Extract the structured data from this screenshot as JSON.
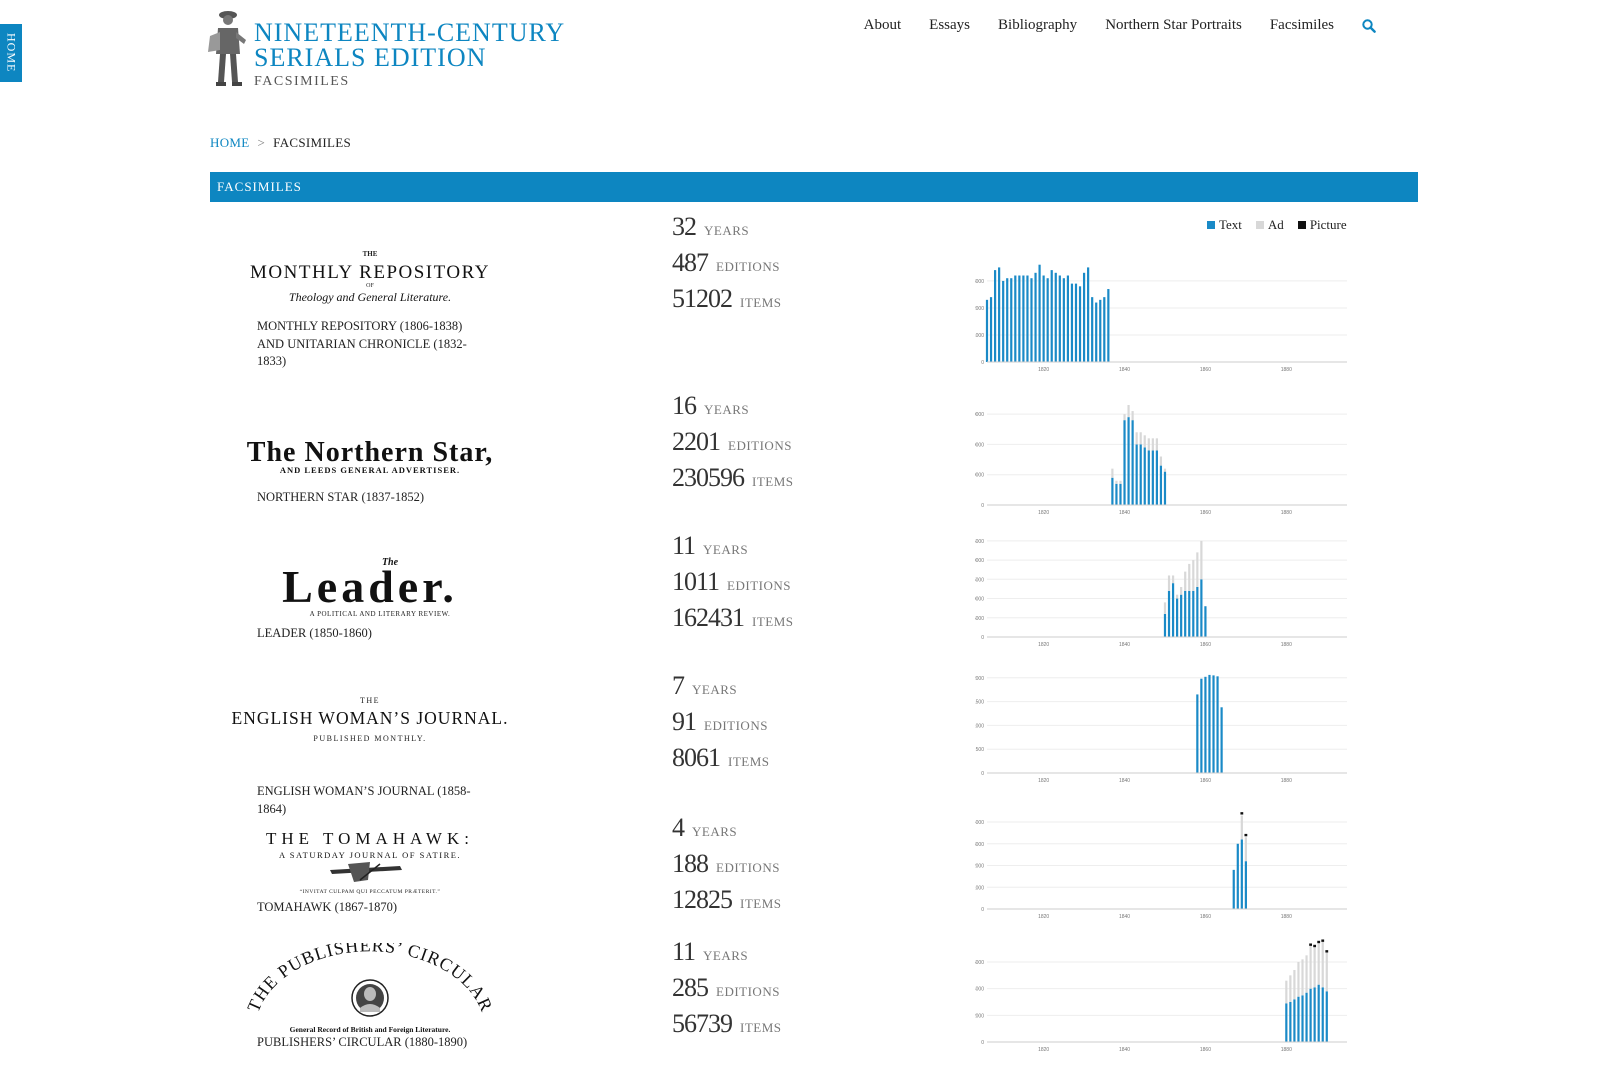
{
  "home_tab": "HOME",
  "logo": {
    "line1": "NINETEENTH-CENTURY",
    "line2": "SERIALS EDITION",
    "sub": "FACSIMILES"
  },
  "nav": [
    "About",
    "Essays",
    "Bibliography",
    "Northern Star Portraits",
    "Facsimiles"
  ],
  "breadcrumb": {
    "home": "HOME",
    "separator": ">",
    "current": "FACSIMILES"
  },
  "section_title": "FACSIMILES",
  "legend": [
    {
      "label": "Text",
      "color": "#1a8ac7"
    },
    {
      "label": "Ad",
      "color": "#d8d8d8"
    },
    {
      "label": "Picture",
      "color": "#111111"
    }
  ],
  "stat_labels": {
    "years": "YEARS",
    "editions": "EDITIONS",
    "items": "ITEMS"
  },
  "publications": [
    {
      "title": "MONTHLY REPOSITORY (1806-1838) AND UNITARIAN CHRONICLE (1832-1833)",
      "masthead": {
        "kicker": "THE",
        "main": "MONTHLY REPOSITORY",
        "of": "OF",
        "sub": "Theology and General Literature."
      },
      "years": "32",
      "editions": "487",
      "items": "51202"
    },
    {
      "title": "NORTHERN STAR (1837-1852)",
      "masthead": {
        "main": "The Northern Star,",
        "sub": "AND LEEDS GENERAL ADVERTISER."
      },
      "years": "16",
      "editions": "2201",
      "items": "230596"
    },
    {
      "title": "LEADER (1850-1860)",
      "masthead": {
        "kicker": "The",
        "main": "Leader.",
        "sub": "A POLITICAL AND LITERARY REVIEW."
      },
      "years": "11",
      "editions": "1011",
      "items": "162431"
    },
    {
      "title": "ENGLISH WOMAN’S JOURNAL (1858-1864)",
      "masthead": {
        "kicker": "THE",
        "main": "ENGLISH WOMAN’S JOURNAL.",
        "sub": "PUBLISHED MONTHLY."
      },
      "years": "7",
      "editions": "91",
      "items": "8061"
    },
    {
      "title": "TOMAHAWK (1867-1870)",
      "masthead": {
        "main": "THE TOMAHAWK:",
        "sub": "A SATURDAY JOURNAL OF SATIRE.",
        "motto": "“INVITAT CULPAM QUI PECCATUM PRÆTERIT.”"
      },
      "years": "4",
      "editions": "188",
      "items": "12825"
    },
    {
      "title": "PUBLISHERS’ CIRCULAR (1880-1890)",
      "masthead": {
        "main": "THE PUBLISHERS’ CIRCULAR",
        "sub": "General Record of British and Foreign Literature."
      },
      "years": "11",
      "editions": "285",
      "items": "56739"
    }
  ],
  "chart_data": [
    {
      "type": "bar",
      "stacked": true,
      "x_ticks": [
        "1820",
        "1840",
        "1860",
        "1880"
      ],
      "xlim": [
        1806,
        1895
      ],
      "y_ticks": [
        "0",
        "1000",
        "2000",
        "3000"
      ],
      "ylim": [
        0,
        3700
      ],
      "x": [
        1806,
        1807,
        1808,
        1809,
        1810,
        1811,
        1812,
        1813,
        1814,
        1815,
        1816,
        1817,
        1818,
        1819,
        1820,
        1821,
        1822,
        1823,
        1824,
        1825,
        1826,
        1827,
        1828,
        1829,
        1830,
        1831,
        1832,
        1833,
        1834,
        1835,
        1836,
        1837,
        1838
      ],
      "series": [
        {
          "name": "Text",
          "values": [
            2300,
            2400,
            3400,
            3500,
            3000,
            3100,
            3100,
            3200,
            3200,
            3200,
            3200,
            3100,
            3300,
            3600,
            3200,
            3100,
            3400,
            3300,
            3200,
            3100,
            3200,
            2900,
            2900,
            2800,
            3300,
            3500,
            2400,
            2200,
            2300,
            2400,
            2700,
            0,
            0
          ]
        },
        {
          "name": "Ad",
          "values": [
            0,
            0,
            0,
            0,
            0,
            0,
            0,
            0,
            0,
            0,
            0,
            0,
            0,
            0,
            0,
            0,
            0,
            0,
            0,
            0,
            0,
            0,
            0,
            0,
            0,
            0,
            0,
            0,
            0,
            0,
            0,
            0,
            0
          ]
        },
        {
          "name": "Picture",
          "values": [
            0,
            0,
            0,
            0,
            0,
            0,
            0,
            0,
            0,
            0,
            0,
            0,
            0,
            0,
            0,
            0,
            0,
            0,
            0,
            0,
            0,
            0,
            0,
            0,
            0,
            0,
            0,
            0,
            0,
            0,
            0,
            0,
            0
          ]
        }
      ]
    },
    {
      "type": "bar",
      "stacked": true,
      "x_ticks": [
        "1820",
        "1840",
        "1860",
        "1880"
      ],
      "xlim": [
        1806,
        1895
      ],
      "y_ticks": [
        "0",
        "10000",
        "20000",
        "30000"
      ],
      "ylim": [
        0,
        33000
      ],
      "x": [
        1837,
        1838,
        1839,
        1840,
        1841,
        1842,
        1843,
        1844,
        1845,
        1846,
        1847,
        1848,
        1849,
        1850,
        1851,
        1852
      ],
      "series": [
        {
          "name": "Text",
          "values": [
            9000,
            7000,
            7000,
            28000,
            29000,
            28000,
            20000,
            20000,
            19000,
            18000,
            18000,
            18000,
            13000,
            11000,
            0,
            0
          ]
        },
        {
          "name": "Ad",
          "values": [
            3000,
            1000,
            1000,
            2000,
            4000,
            3000,
            4000,
            4000,
            4000,
            4000,
            4000,
            4000,
            3000,
            1000,
            0,
            0
          ]
        },
        {
          "name": "Picture",
          "values": [
            0,
            0,
            0,
            0,
            0,
            0,
            0,
            0,
            0,
            0,
            0,
            0,
            0,
            0,
            0,
            0
          ]
        }
      ]
    },
    {
      "type": "bar",
      "stacked": true,
      "x_ticks": [
        "1820",
        "1840",
        "1860",
        "1880"
      ],
      "xlim": [
        1806,
        1895
      ],
      "y_ticks": [
        "0",
        "5000",
        "10000",
        "15000",
        "20000",
        "25000"
      ],
      "ylim": [
        0,
        26000
      ],
      "x": [
        1850,
        1851,
        1852,
        1853,
        1854,
        1855,
        1856,
        1857,
        1858,
        1859,
        1860
      ],
      "series": [
        {
          "name": "Text",
          "values": [
            6000,
            12000,
            14000,
            10000,
            11000,
            12000,
            12000,
            12000,
            13000,
            15000,
            8000
          ]
        },
        {
          "name": "Ad",
          "values": [
            3000,
            4000,
            2000,
            1000,
            2000,
            5000,
            7000,
            8000,
            9000,
            10000,
            0
          ]
        },
        {
          "name": "Picture",
          "values": [
            0,
            0,
            0,
            0,
            0,
            0,
            0,
            0,
            0,
            0,
            0
          ]
        }
      ]
    },
    {
      "type": "bar",
      "stacked": true,
      "x_ticks": [
        "1820",
        "1840",
        "1860",
        "1880"
      ],
      "xlim": [
        1806,
        1895
      ],
      "y_ticks": [
        "0",
        "500",
        "1000",
        "1500",
        "2000"
      ],
      "ylim": [
        0,
        2100
      ],
      "x": [
        1858,
        1859,
        1860,
        1861,
        1862,
        1863,
        1864
      ],
      "series": [
        {
          "name": "Text",
          "values": [
            1650,
            1980,
            2020,
            2060,
            2050,
            2030,
            1380
          ]
        },
        {
          "name": "Ad",
          "values": [
            0,
            0,
            0,
            0,
            0,
            0,
            0
          ]
        },
        {
          "name": "Picture",
          "values": [
            0,
            0,
            0,
            0,
            0,
            0,
            0
          ]
        }
      ]
    },
    {
      "type": "bar",
      "stacked": true,
      "x_ticks": [
        "1820",
        "1840",
        "1860",
        "1880"
      ],
      "xlim": [
        1806,
        1895
      ],
      "y_ticks": [
        "0",
        "1000",
        "2000",
        "3000",
        "4000"
      ],
      "ylim": [
        0,
        4600
      ],
      "x": [
        1867,
        1868,
        1869,
        1870
      ],
      "series": [
        {
          "name": "Text",
          "values": [
            1800,
            3000,
            3200,
            2200
          ]
        },
        {
          "name": "Ad",
          "values": [
            0,
            0,
            1100,
            1100
          ]
        },
        {
          "name": "Picture",
          "values": [
            0,
            0,
            100,
            100
          ]
        }
      ]
    },
    {
      "type": "bar",
      "stacked": true,
      "x_ticks": [
        "1820",
        "1840",
        "1860",
        "1880"
      ],
      "xlim": [
        1806,
        1895
      ],
      "y_ticks": [
        "0",
        "2000",
        "4000",
        "6000"
      ],
      "ylim": [
        0,
        7500
      ],
      "x": [
        1880,
        1881,
        1882,
        1883,
        1884,
        1885,
        1886,
        1887,
        1888,
        1889,
        1890
      ],
      "series": [
        {
          "name": "Text",
          "values": [
            2900,
            3000,
            3200,
            3400,
            3500,
            3700,
            4000,
            4100,
            4300,
            4100,
            3800
          ]
        },
        {
          "name": "Ad",
          "values": [
            1700,
            2000,
            2200,
            2600,
            2700,
            2800,
            3200,
            3000,
            3100,
            3400,
            2900
          ]
        },
        {
          "name": "Picture",
          "values": [
            0,
            0,
            0,
            0,
            0,
            0,
            100,
            100,
            100,
            100,
            100
          ]
        }
      ]
    }
  ]
}
